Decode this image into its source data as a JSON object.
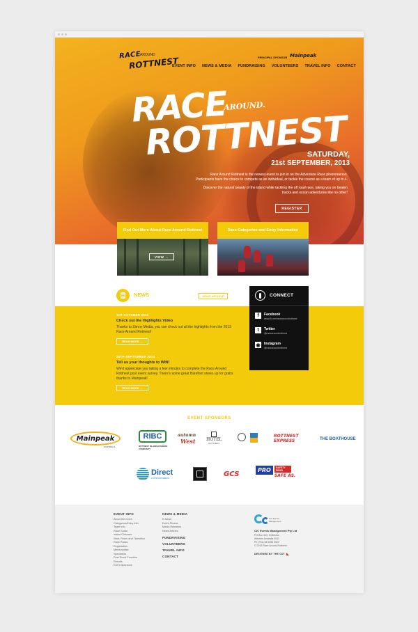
{
  "logo": {
    "line1": "RACE",
    "line2": "ROTTNEST",
    "around": "AROUND"
  },
  "nav": [
    "EVENT INFO",
    "NEWS & MEDIA",
    "FUNDRAISING",
    "VOLUNTEERS",
    "TRAVEL INFO",
    "CONTACT"
  ],
  "principal_sponsor": {
    "label": "PRINCIPAL SPONSOR",
    "name": "Mainpeak"
  },
  "hero": {
    "title_top": "RACE",
    "title_around": "AROUND.",
    "title_bottom": "ROTTNEST",
    "date_day": "SATURDAY,",
    "date_full": "21st SEPTEMBER, 2013",
    "paragraph1": "Race Around Rottnest is the newest event to join in on the Adventure Race phenomenon. Participants have the choice to compete as an individual, or tackle the course as a team of up to 4.",
    "paragraph2": "Discover the natural beauty of the island while tackling the off road race, taking you on beaten tracks and ocean adventures like no other!",
    "register": "REGISTER"
  },
  "promos": [
    {
      "heading": "Find Out More About Race Around Rottnest",
      "button": "VIEW  →"
    },
    {
      "heading": "Race Categories and Entry Information"
    }
  ],
  "news": {
    "title": "NEWS",
    "archive": "NEWS ARCHIVE",
    "items": [
      {
        "date": "1ST OCTOBER 2013",
        "title": "Check out the Highlights Video",
        "text": "Thanks to Zanny Media, you can check out all the highlights from the 2013 Race Around Rottnest!",
        "more": "READ MORE  →"
      },
      {
        "date": "26TH SEPTEMBER 2013",
        "title": "Tell us your thoughts to WIN!",
        "text": "We'd appreciate you taking a few minutes to complete the Race Around Rottnest post event survey. There's some great Barefoot shoes up for grabs thanks to Mainpeak!",
        "more": "READ MORE  →"
      }
    ]
  },
  "connect": {
    "title": "CONNECT",
    "items": [
      {
        "icon": "facebook-icon",
        "name": "Facebook",
        "handle": "www.fb.me/racearoundrottnest"
      },
      {
        "icon": "twitter-icon",
        "name": "Twitter",
        "handle": "@racearoundrottnest"
      },
      {
        "icon": "instagram-icon",
        "name": "Instagram",
        "handle": "@racearoundrottnest"
      }
    ]
  },
  "sponsors": {
    "title": "EVENT SPONSORS",
    "mainpeak": "Mainpeak",
    "mainpeak_sub": "AUSTRALIA",
    "ribc": "RIBC",
    "ribc_sub": "ROTTNEST ISLAND BUSINESS COMMUNITY",
    "autumn": "autumn",
    "west": "West",
    "hotel": "HOTEL",
    "hotel_sub": "ROTTNEST",
    "rottnest_express": "ROTTNEST EXPRESS",
    "boathouse": "THE BOATHOUSE",
    "direct": "Direct",
    "direct_sub": "Communications",
    "gcs": "GCS",
    "pro": "PRO",
    "safety_gear": "SAFETY GEAR",
    "safe_as": "SAFE AS."
  },
  "footer": {
    "event_info": {
      "heading": "EVENT INFO",
      "links": [
        "About the event",
        "Categories/Entry Info",
        "Team Info",
        "Race Guide",
        "Island Closures",
        "Start, Finish and Transition",
        "Race Packs",
        "Registration",
        "Merchandise",
        "Spectators",
        "Post Event Function",
        "Results",
        "Event Sponsors"
      ]
    },
    "news_media": {
      "heading": "NEWS & MEDIA",
      "links": [
        "E-News",
        "Event Photos",
        "Media Releases",
        "News Articles"
      ]
    },
    "others": [
      "FUNDRAISING",
      "VOLUNTEERS",
      "TRAVEL INFO",
      "CONTACT"
    ],
    "cic_mark": "CiC Events Management",
    "company": "CIC Events Management Pty Ltd",
    "address": [
      "PO Box 443, Cottesloe,",
      "Western Australia 6911",
      "Ph (+61) 08 9286 3522",
      "© 2013 Race Around Rottnest"
    ],
    "designed": "DESIGNED BY THE CUT"
  }
}
